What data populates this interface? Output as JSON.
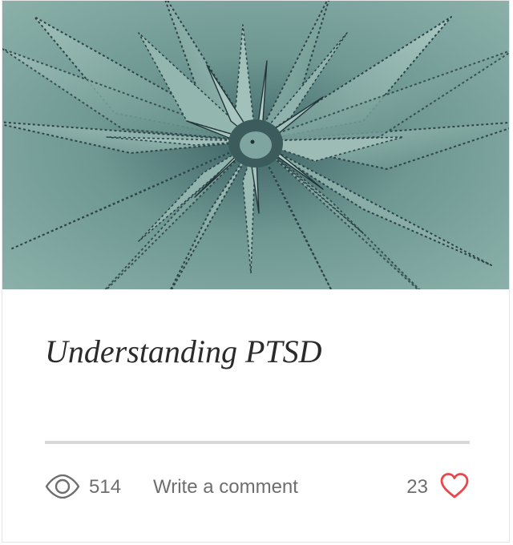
{
  "post": {
    "cover_image": "agave-succulent-photo",
    "title": "Understanding PTSD"
  },
  "stats": {
    "views_icon": "eye-icon",
    "views": "514",
    "comment_label": "Write a comment",
    "likes": "23",
    "like_icon": "heart-icon"
  },
  "colors": {
    "heart": "#e8474c",
    "text_muted": "#6e6e6e",
    "title": "#2b2b2b",
    "divider": "#d8d8d8",
    "image_tone": "#6f9a95"
  }
}
